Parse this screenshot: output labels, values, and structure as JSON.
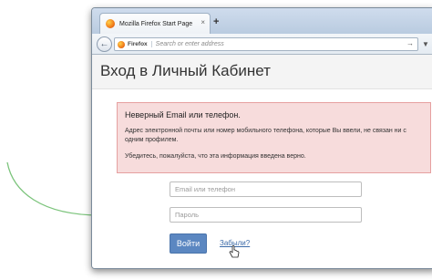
{
  "browser": {
    "tab_title": "Mozilla Firefox Start Page",
    "tab_close": "×",
    "new_tab": "+",
    "back": "←",
    "url_label": "Firefox",
    "url_placeholder": "Search or enter address",
    "url_go": "→",
    "navbar_extra": "▼",
    "icon": "firefox-logo-icon"
  },
  "page": {
    "title": "Вход в Личный Кабинет"
  },
  "error": {
    "title": "Неверный Email или телефон.",
    "message": "Адрес электронной почты или номер мобильного телефона, которые Вы ввели, не связан ни с одним профилем.",
    "hint": "Убедитесь, пожалуйста, что эта информация введена верно."
  },
  "form": {
    "email_placeholder": "Email или телефон",
    "password_placeholder": "Пароль",
    "login_label": "Войти",
    "forgot_label": "Забыли?"
  },
  "colors": {
    "error_bg": "#f7dcdc",
    "error_border": "#e6a0a0",
    "button": "#5b87c1",
    "link": "#3b6aa8",
    "curve": "#7cc47c"
  }
}
